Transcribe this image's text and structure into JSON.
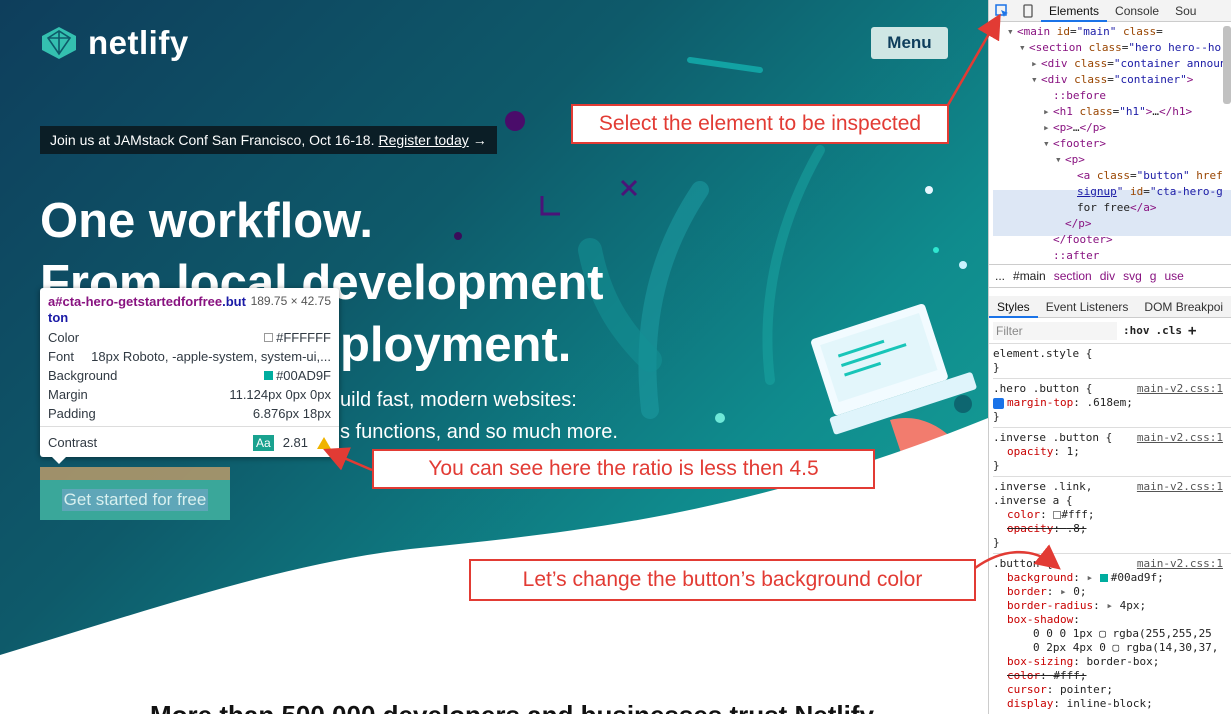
{
  "site": {
    "logo_text": "netlify",
    "menu_label": "Menu",
    "announcement": {
      "text": "Join us at JAMstack Conf San Francisco, Oct 16-18.",
      "link": "Register today",
      "arrow": "→"
    },
    "hero_lines": [
      "One workflow.",
      "From local development",
      "ployment."
    ],
    "sub_lines": [
      "uild fast, modern websites:",
      "s functions, and so much more."
    ],
    "cta_label": "Get started for free",
    "bottom_text": "More than 500,000 developers and businesses trust Netlify"
  },
  "tooltip": {
    "selector_tag": "a",
    "selector_id": "#cta-hero-getstartedforfree",
    "selector_class": ".button",
    "size": "189.75 × 42.75",
    "rows": [
      {
        "label": "Color",
        "value": "#FFFFFF",
        "swatch": "#FFFFFF"
      },
      {
        "label": "Font",
        "value": "18px Roboto, -apple-system, system-ui,..."
      },
      {
        "label": "Background",
        "value": "#00AD9F",
        "swatch": "#00AD9F"
      },
      {
        "label": "Margin",
        "value": "11.124px 0px 0px"
      },
      {
        "label": "Padding",
        "value": "6.876px 18px"
      }
    ],
    "contrast_label": "Contrast",
    "contrast_badge": "Aa",
    "contrast_value": "2.81"
  },
  "callouts": {
    "select": "Select  the element to be inspected",
    "ratio": "You can see here the ratio is less then 4.5",
    "change": "Let’s change the button’s background color"
  },
  "devtools": {
    "tabs": [
      "Elements",
      "Console",
      "Sou"
    ],
    "dom": [
      {
        "indent": 0,
        "arrow": "▾",
        "html": "<span class='tag'>&lt;main</span> <span class='attr'>id</span>=<span class='aval'>\"main\"</span> <span class='attr'>class</span>="
      },
      {
        "indent": 1,
        "arrow": "▾",
        "html": "<span class='tag'>&lt;section</span> <span class='attr'>class</span>=<span class='aval'>\"hero hero--ho</span>"
      },
      {
        "indent": 2,
        "arrow": "▸",
        "html": "<span class='tag'>&lt;div</span> <span class='attr'>class</span>=<span class='aval'>\"container announ</span>"
      },
      {
        "indent": 2,
        "arrow": "▾",
        "html": "<span class='tag'>&lt;div</span> <span class='attr'>class</span>=<span class='aval'>\"container\"</span><span class='tag'>&gt;</span>"
      },
      {
        "indent": 3,
        "arrow": "",
        "html": "<span class='pseudo'>::before</span>"
      },
      {
        "indent": 3,
        "arrow": "▸",
        "html": "<span class='tag'>&lt;h1</span> <span class='attr'>class</span>=<span class='aval'>\"h1\"</span><span class='tag'>&gt;</span>…<span class='tag'>&lt;/h1&gt;</span>"
      },
      {
        "indent": 3,
        "arrow": "▸",
        "html": "<span class='tag'>&lt;p&gt;</span>…<span class='tag'>&lt;/p&gt;</span>"
      },
      {
        "indent": 3,
        "arrow": "▾",
        "html": "<span class='tag'>&lt;footer&gt;</span>"
      },
      {
        "indent": 4,
        "arrow": "▾",
        "html": "<span class='tag'>&lt;p&gt;</span>"
      },
      {
        "indent": 5,
        "arrow": "",
        "html": "<span class='tag'>&lt;a</span> <span class='attr'>class</span>=<span class='aval'>\"button\"</span> <span class='attr'>href</span>"
      },
      {
        "indent": 5,
        "arrow": "",
        "html": "<span class='aval' style='text-decoration:underline'>signup</span><span class='aval'>\"</span> <span class='attr'>id</span>=<span class='aval'>\"cta-hero-g</span>"
      },
      {
        "indent": 5,
        "arrow": "",
        "html": "for free<span class='tag'>&lt;/a&gt;</span>"
      },
      {
        "indent": 4,
        "arrow": "",
        "html": "<span class='tag'>&lt;/p&gt;</span>"
      },
      {
        "indent": 3,
        "arrow": "",
        "html": "<span class='tag'>&lt;/footer&gt;</span>"
      },
      {
        "indent": 3,
        "arrow": "",
        "html": "<span class='pseudo'>::after</span>"
      }
    ],
    "breadcrumbs": [
      "...",
      "#main",
      "section",
      "div",
      "svg",
      "g",
      "use"
    ],
    "styles_tabs": [
      "Styles",
      "Event Listeners",
      "DOM Breakpoi"
    ],
    "filter_placeholder": "Filter",
    "hov": ":hov",
    "cls": ".cls",
    "plus": "+",
    "element_style": "element.style {",
    "src": "main-v2.css:1",
    "hero_button_selector": ".hero .button {",
    "hero_button_prop": "margin-top",
    "hero_button_val": ".618em;",
    "inverse_selector": ".inverse .button {",
    "inverse_prop": "opacity",
    "inverse_val": "1;",
    "link_selector_1": ".inverse .link,",
    "link_selector_2": ".inverse a {",
    "link_color_prop": "color",
    "link_color_val": "#fff;",
    "link_opacity_prop": "opacity",
    "link_opacity_val": ".8;",
    "button_selector": ".button {",
    "button_props": [
      {
        "name": "background",
        "value": "#00ad9f;",
        "arrow": true,
        "swatch": "#00ad9f"
      },
      {
        "name": "border",
        "value": "0;",
        "arrow": true
      },
      {
        "name": "border-radius",
        "value": "4px;",
        "arrow": true
      },
      {
        "name": "box-shadow",
        "value": ""
      },
      {
        "name": "",
        "value": "0 0 0 1px ▢ rgba(255,255,25",
        "sub": true
      },
      {
        "name": "",
        "value": "0 2px 4px 0 ▢ rgba(14,30,37,",
        "sub": true
      },
      {
        "name": "box-sizing",
        "value": "border-box;"
      },
      {
        "name": "color",
        "value": "#fff;",
        "strike": true
      },
      {
        "name": "cursor",
        "value": "pointer;"
      },
      {
        "name": "display",
        "value": "inline-block;"
      }
    ]
  },
  "colors": {
    "accent": "#00AD9F",
    "callout_red": "#e23b34"
  }
}
